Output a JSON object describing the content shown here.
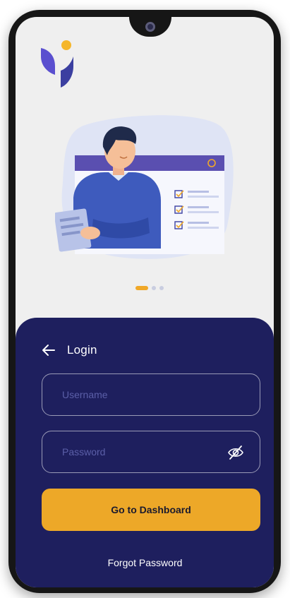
{
  "login": {
    "title": "Login",
    "username_placeholder": "Username",
    "password_placeholder": "Password",
    "submit_label": "Go to Dashboard",
    "forgot_label": "Forgot Password"
  },
  "carousel": {
    "page_count": 3,
    "active_index": 0
  },
  "colors": {
    "brand_navy": "#1e1f5e",
    "accent_yellow": "#eda828",
    "logo_purple": "#5a4fcf",
    "logo_indigo": "#3b3fa0",
    "logo_dot": "#f5b62a"
  },
  "icons": {
    "back": "back-arrow-icon",
    "password_toggle": "eye-slash-icon",
    "logo": "app-logo"
  }
}
